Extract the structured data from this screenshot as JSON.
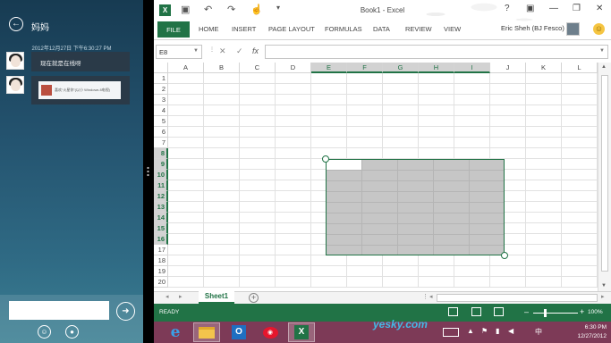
{
  "chat": {
    "title": "妈妈",
    "timestamp": "2012年12月27日 下午6:30:27 PM",
    "messages": [
      {
        "text": "现在就是在线呀"
      },
      {
        "card_text": "喜欢“火星你”(以小 Windows 8电视)"
      }
    ],
    "input_placeholder": ""
  },
  "excel": {
    "window_title": "Book1 - Excel",
    "tabs": [
      "FILE",
      "HOME",
      "INSERT",
      "PAGE LAYOUT",
      "FORMULAS",
      "DATA",
      "REVIEW",
      "VIEW"
    ],
    "user_name": "Eric Sheh (BJ Fesco)",
    "name_box": "E8",
    "formula_icons": [
      "✕",
      "✓",
      "fx"
    ],
    "columns": [
      "A",
      "B",
      "C",
      "D",
      "E",
      "F",
      "G",
      "H",
      "I",
      "J",
      "K",
      "L"
    ],
    "selected_columns": [
      "E",
      "F",
      "G",
      "H",
      "I"
    ],
    "rows": [
      "1",
      "2",
      "3",
      "4",
      "5",
      "6",
      "7",
      "8",
      "9",
      "10",
      "11",
      "12",
      "13",
      "14",
      "15",
      "16",
      "17",
      "18",
      "19",
      "20"
    ],
    "selected_rows": [
      "8",
      "9",
      "10",
      "11",
      "12",
      "13",
      "14",
      "15",
      "16"
    ],
    "active_cell": "E8",
    "sheet_tab": "Sheet1",
    "status": "READY",
    "zoom": "100%"
  },
  "taskbar": {
    "apps": [
      "internet-explorer",
      "file-explorer",
      "outlook",
      "weibo",
      "excel"
    ],
    "time": "6:30 PM",
    "date": "12/27/2012",
    "watermark": "yesky.com"
  }
}
